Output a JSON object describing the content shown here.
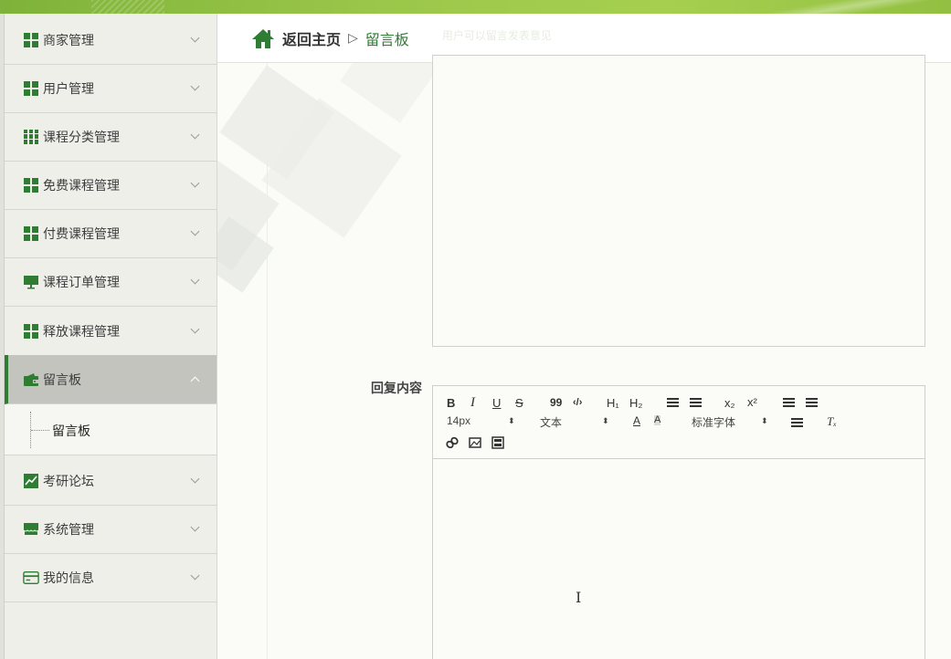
{
  "header": {
    "back_home": "返回主页",
    "separator": "▷",
    "current": "留言板",
    "marquee": "用户可以留言发表意见"
  },
  "sidebar": {
    "items": [
      {
        "label": "商家管理",
        "icon": "grid4-icon"
      },
      {
        "label": "用户管理",
        "icon": "grid4-icon"
      },
      {
        "label": "课程分类管理",
        "icon": "grid9-icon"
      },
      {
        "label": "免费课程管理",
        "icon": "grid4-icon"
      },
      {
        "label": "付费课程管理",
        "icon": "grid4-icon"
      },
      {
        "label": "课程订单管理",
        "icon": "monitor-icon"
      },
      {
        "label": "释放课程管理",
        "icon": "grid4-icon"
      },
      {
        "label": "留言板",
        "icon": "wallet-icon",
        "active": true
      },
      {
        "label": "考研论坛",
        "icon": "chart-icon"
      },
      {
        "label": "系统管理",
        "icon": "store-icon"
      },
      {
        "label": "我的信息",
        "icon": "card-icon"
      }
    ],
    "sub_item": "留言板"
  },
  "form": {
    "reply_label": "回复内容"
  },
  "editor": {
    "toolbar": {
      "bold": "B",
      "italic": "I",
      "underline": "U",
      "strike": "S",
      "quote": "99",
      "code": "‹/›",
      "h1": "H₁",
      "h2": "H₂",
      "sub": "x₂",
      "sup": "x²",
      "size_value": "14px",
      "header_value": "文本",
      "font_value": "标准字体",
      "clean": "Tₓ"
    }
  },
  "colors": {
    "accent": "#2e7d32",
    "topbar": "#9bc74a"
  }
}
